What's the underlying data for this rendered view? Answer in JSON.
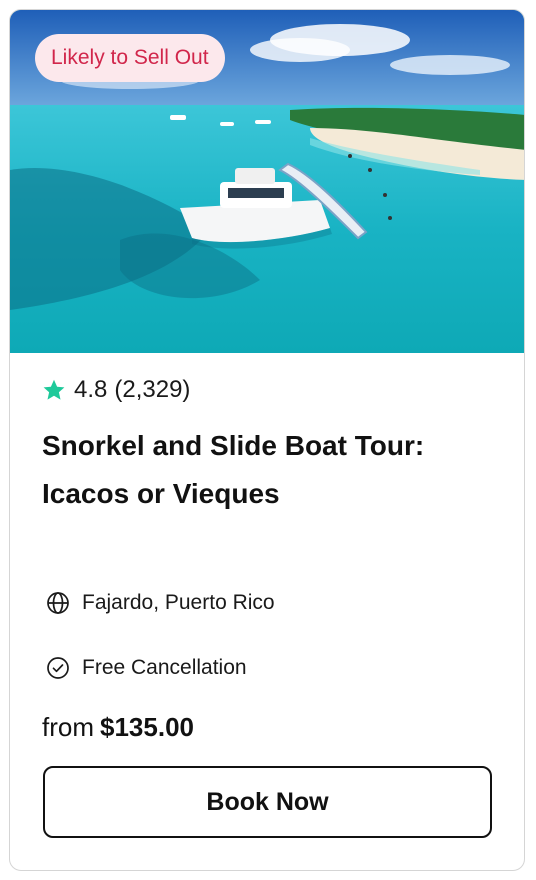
{
  "card": {
    "badge": "Likely to Sell Out",
    "image_alt": "Boat with slide anchored in turquoise water near a beach",
    "rating": {
      "score": "4.8",
      "count": "(2,329)"
    },
    "title": "Snorkel and Slide Boat Tour: Icacos or Vieques",
    "location": "Fajardo, Puerto Rico",
    "cancellation": "Free Cancellation",
    "price_prefix": "from",
    "price": "$135.00",
    "cta_label": "Book Now"
  },
  "colors": {
    "badge_text": "#d1264b",
    "badge_bg": "#fce8ec",
    "star": "#1ec99a",
    "border": "#d5d5d5"
  },
  "icons": {
    "star": "star-icon",
    "location": "globe-icon",
    "cancellation": "check-circle-icon"
  }
}
